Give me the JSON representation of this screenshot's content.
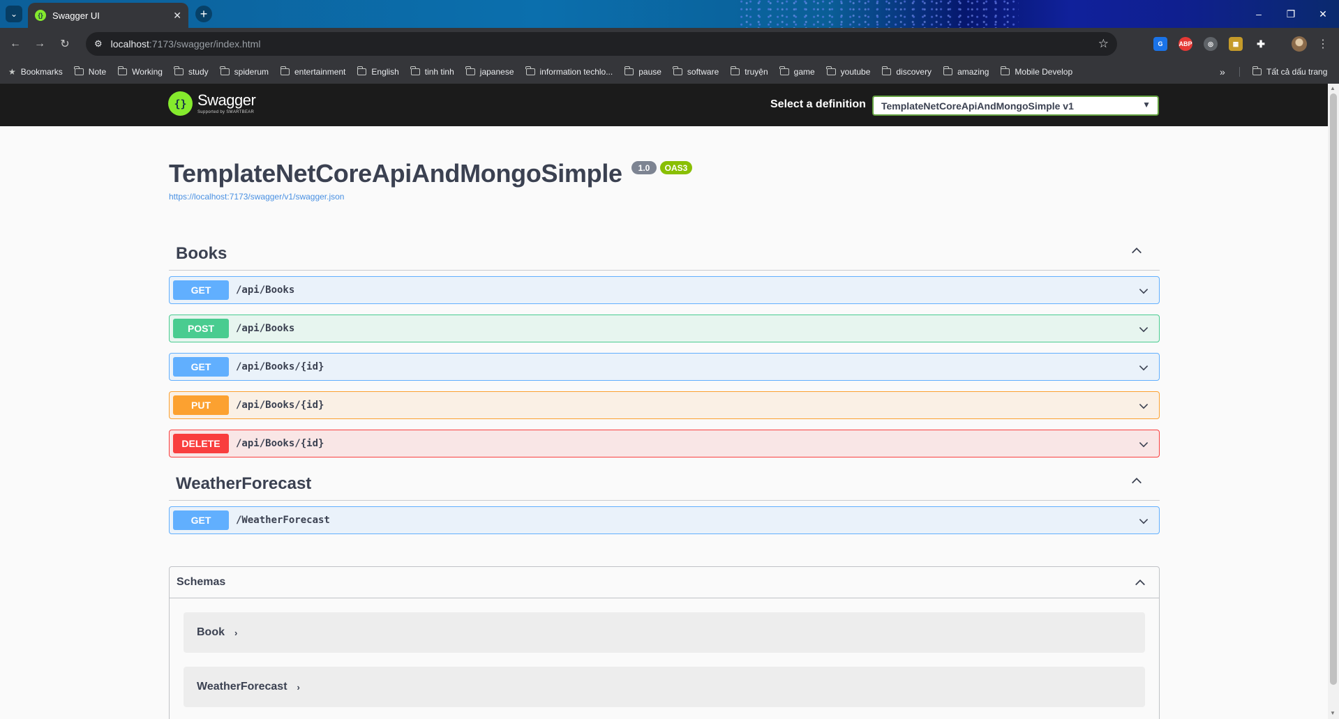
{
  "browser": {
    "tab_title": "Swagger UI",
    "url_host": "localhost",
    "url_path": ":7173/swagger/index.html",
    "bookmarks_label": "Bookmarks",
    "bookmark_folders": [
      "Note",
      "Working",
      "study",
      "spiderum",
      "entertainment",
      "English",
      "tinh tinh",
      "japanese",
      "information techlo...",
      "pause",
      "software",
      "truyện",
      "game",
      "youtube",
      "discovery",
      "amazing",
      "Mobile Develop"
    ],
    "all_bookmarks_label": "Tất cả dấu trang"
  },
  "topbar": {
    "logo_name": "Swagger",
    "logo_sub": "Supported by SMARTBEAR",
    "definition_label": "Select a definition",
    "definition_selected": "TemplateNetCoreApiAndMongoSimple v1"
  },
  "info": {
    "title": "TemplateNetCoreApiAndMongoSimple",
    "version": "1.0",
    "oas": "OAS3",
    "url": "https://localhost:7173/swagger/v1/swagger.json"
  },
  "tags": [
    {
      "name": "Books",
      "operations": [
        {
          "method": "GET",
          "path": "/api/Books"
        },
        {
          "method": "POST",
          "path": "/api/Books"
        },
        {
          "method": "GET",
          "path": "/api/Books/{id}"
        },
        {
          "method": "PUT",
          "path": "/api/Books/{id}"
        },
        {
          "method": "DELETE",
          "path": "/api/Books/{id}"
        }
      ]
    },
    {
      "name": "WeatherForecast",
      "operations": [
        {
          "method": "GET",
          "path": "/WeatherForecast"
        }
      ]
    }
  ],
  "schemas": {
    "label": "Schemas",
    "models": [
      "Book",
      "WeatherForecast"
    ]
  },
  "colors": {
    "get": "#61affe",
    "post": "#49cc90",
    "put": "#fca130",
    "delete": "#f93e3e",
    "swagger_green": "#85ea2d",
    "topbar_bg": "#1b1b1b"
  }
}
